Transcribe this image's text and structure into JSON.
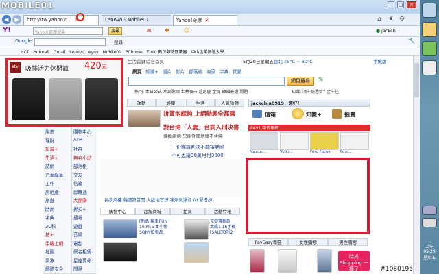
{
  "browser": {
    "brand": "MOBILE01",
    "address": "http://tw.yahoo.c...",
    "tabs": [
      "Lenovo - Mobile01",
      "Yahoo!奇摩"
    ],
    "yahoo_search_placeholder": "Yahoo!奇摩搜尋",
    "toolbar_search_btn": "搜尋",
    "user_label": "jackch...",
    "google_label": "Google",
    "google_search_btn": "搜尋",
    "bookmarks": [
      "HCT",
      "Hotmail",
      "Gmail",
      "Lenovo",
      "eyny",
      "Mobile01",
      "PChome",
      "Zinio 數位雜誌閱讀器",
      "中山企業網路大學"
    ]
  },
  "ad": {
    "atv": "atv",
    "title": "吸排活力休閒褲",
    "price": "420",
    "unit": "元"
  },
  "yahoo": {
    "top_links": [
      "生活首頁",
      "綜合首頁"
    ],
    "date": "5月20日星期五",
    "weather": "台北 25°C ~ 30°C",
    "mobile_link": "手機版",
    "search_tabs": [
      "網頁",
      "知識+",
      "圖片",
      "影片",
      "部落格",
      "商家",
      "字典",
      "問題"
    ],
    "search_button": "網頁搜尋",
    "hot_searches": "熱門: 本日公式 水調歌頭 士林夜市 超跑慶 金價 韓國簽證 問題",
    "knowledge": "知識: 鴻牛奶過怡? 金牛往",
    "section_tabs": [
      "運動",
      "娛樂",
      "生活",
      "人氣話題"
    ],
    "sidebar_left": [
      "說市",
      "理財",
      "知識+",
      "生活+",
      "誌網",
      "汽車綠車",
      "工作",
      "房地產",
      "旅遊",
      "時尚",
      "字典",
      "3C科",
      "技+",
      "手機上網",
      "地圖",
      "氣象",
      "網路安全"
    ],
    "sidebar_mid": [
      "購物中心",
      "ATM",
      "社群",
      "無名小站",
      "部落格",
      "交友",
      "信箱",
      "即時通",
      "大團購",
      "折扣+",
      "搜尋",
      "遊戲",
      "音樂",
      "電影",
      "網名相簿",
      "星座算命",
      "問話"
    ],
    "headlines": [
      "拚賞泡餛飩 上網動態全都露",
      "對台湾「人妻」台詞入刑決書"
    ],
    "headline_sub": "偶換劇組 只能怪國地鐵不住院",
    "news": [
      "一份鑑識判決不能審老剛",
      "不可思議30萬月付3800"
    ],
    "promo_bar": "長浪炳樓 韓國第首開 大陸地官博 凍劑氣浮弱 OL緊搭扮",
    "user_greeting": "jackchia0919，您好！",
    "icons": [
      "信箱",
      "知識+",
      "拍賣"
    ],
    "used_car_section": "8891 中古車網",
    "cars": [
      "Mazda...",
      "Volks...",
      "Ford Focus",
      "Ford..."
    ],
    "shopping_tabs": [
      "購物中心",
      "超級商城",
      "拍賣",
      "活動特報"
    ],
    "shopping_items": [
      "[新品]機車FUN+",
      "100%日本小物",
      "SONY拍相品",
      "充電寶新款",
      "太陽1.16手機",
      "[SALE]3折2"
    ],
    "bottom_tabs": [
      "PayEasy專區",
      "女性購物",
      "男性購物"
    ],
    "fashion_tag": "時尚Shopping 一樣子"
  },
  "system": {
    "time": "上午 09:29",
    "weekday": "星期五",
    "watermark": "#1080195"
  },
  "colors": {
    "ad_border": "#cf2c39",
    "price": "#d4161c",
    "yahoo_purple": "#6b1b9a",
    "headline": "#bd2d2d"
  }
}
